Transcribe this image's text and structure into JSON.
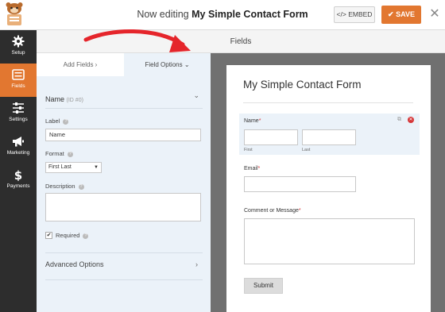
{
  "header": {
    "prefix": "Now editing",
    "form_name": "My Simple Contact Form",
    "embed_icon": "</>",
    "embed_label": "EMBED",
    "save_icon": "✔",
    "save_label": "SAVE",
    "close_icon": "✕",
    "accent_color": "#e27730"
  },
  "sidebar": {
    "items": [
      {
        "label": "Setup",
        "icon": "gear-icon"
      },
      {
        "label": "Fields",
        "icon": "list-icon"
      },
      {
        "label": "Settings",
        "icon": "sliders-icon"
      },
      {
        "label": "Marketing",
        "icon": "megaphone-icon"
      },
      {
        "label": "Payments",
        "icon": "dollar-icon"
      }
    ]
  },
  "section": {
    "title": "Fields"
  },
  "panel": {
    "tabs": [
      {
        "label": "Add Fields",
        "chevron": "›"
      },
      {
        "label": "Field Options",
        "chevron": "⌄"
      }
    ],
    "field_name": "Name",
    "field_id": "(ID #0)",
    "field_chevron": "⌄",
    "label_caption": "Label",
    "label_value": "Name",
    "format_caption": "Format",
    "format_value": "First Last",
    "format_arrow": "▼",
    "description_caption": "Description",
    "required_label": "Required",
    "required_checked": true,
    "required_mark": "✔",
    "advanced_label": "Advanced Options",
    "advanced_chevron": "›",
    "help_glyph": "?"
  },
  "preview": {
    "form_title": "My Simple Contact Form",
    "name_label": "Name",
    "required_star": "*",
    "first_label": "First",
    "last_label": "Last",
    "email_label": "Email",
    "message_label": "Comment or Message",
    "submit_label": "Submit",
    "duplicate_icon": "⧉",
    "delete_icon": "✕"
  }
}
